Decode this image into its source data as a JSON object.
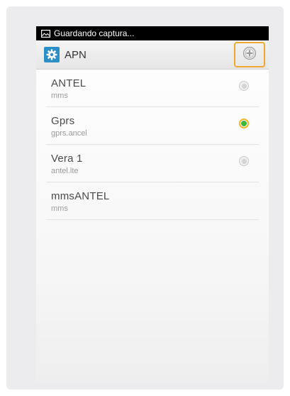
{
  "status_bar": {
    "text": "Guardando captura...",
    "icon": "screenshot-icon"
  },
  "action_bar": {
    "title": "APN",
    "app_icon": "gear-icon",
    "add_icon": "add-circle-icon"
  },
  "colors": {
    "accent_highlight": "#f0a830",
    "app_icon_bg": "#2b8fc6",
    "radio_selected": "#3fb63f"
  },
  "apns": [
    {
      "name": "ANTEL",
      "apn": "mms",
      "selected": false
    },
    {
      "name": "Gprs",
      "apn": "gprs.ancel",
      "selected": true
    },
    {
      "name": "Vera 1",
      "apn": "antel.lte",
      "selected": false
    },
    {
      "name": "mmsANTEL",
      "apn": "mms",
      "selected": null
    }
  ]
}
